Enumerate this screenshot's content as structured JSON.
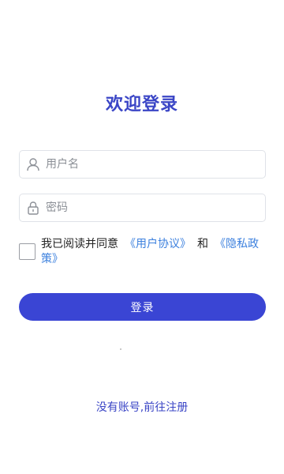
{
  "login": {
    "title": "欢迎登录",
    "username": {
      "placeholder": "用户名",
      "icon": "user-icon"
    },
    "password": {
      "placeholder": "密码",
      "icon": "lock-icon"
    },
    "agreement": {
      "prefix": "我已阅读并同意",
      "user_agreement": "《用户协议》",
      "and": "和",
      "privacy_policy": "《隐私政策》"
    },
    "login_button": "登录",
    "register_link": "没有账号,前往注册"
  },
  "colors": {
    "brand": "#3a45c6",
    "button": "#3a45d4",
    "link": "#3c80de",
    "border": "#dfe2e8"
  }
}
